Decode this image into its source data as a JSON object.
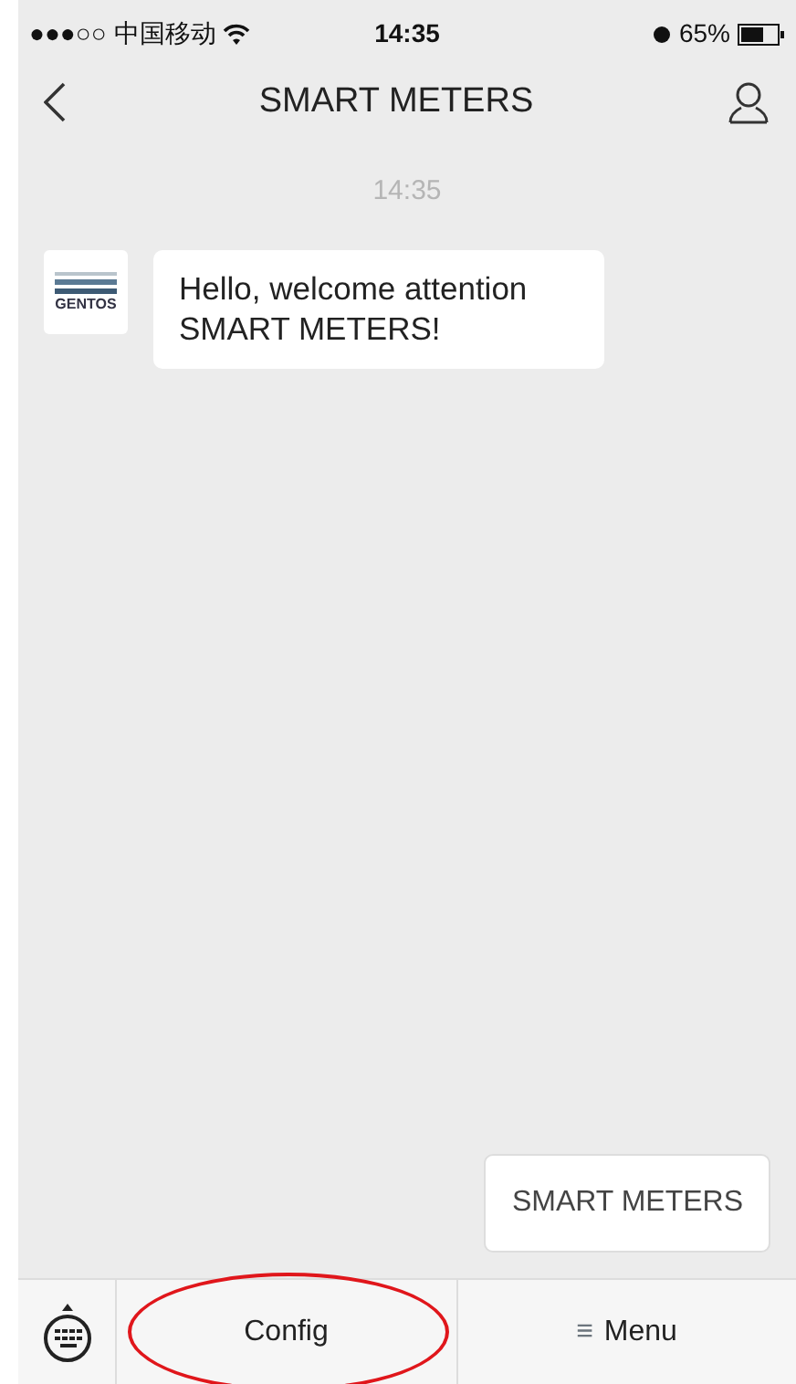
{
  "status_bar": {
    "signal": "●●●○○",
    "carrier": "中国移动",
    "time": "14:35",
    "battery": "65%"
  },
  "nav": {
    "title": "SMART METERS"
  },
  "chat": {
    "timestamp": "14:35",
    "messages": [
      {
        "avatar_text": "GENTOS",
        "text": "Hello, welcome attention SMART METERS!"
      }
    ]
  },
  "popup": {
    "text": "SMART METERS"
  },
  "bottom_menu": [
    {
      "label": "Config",
      "circled": true
    },
    {
      "label": "Menu",
      "icon": "≡",
      "circled": false
    }
  ]
}
